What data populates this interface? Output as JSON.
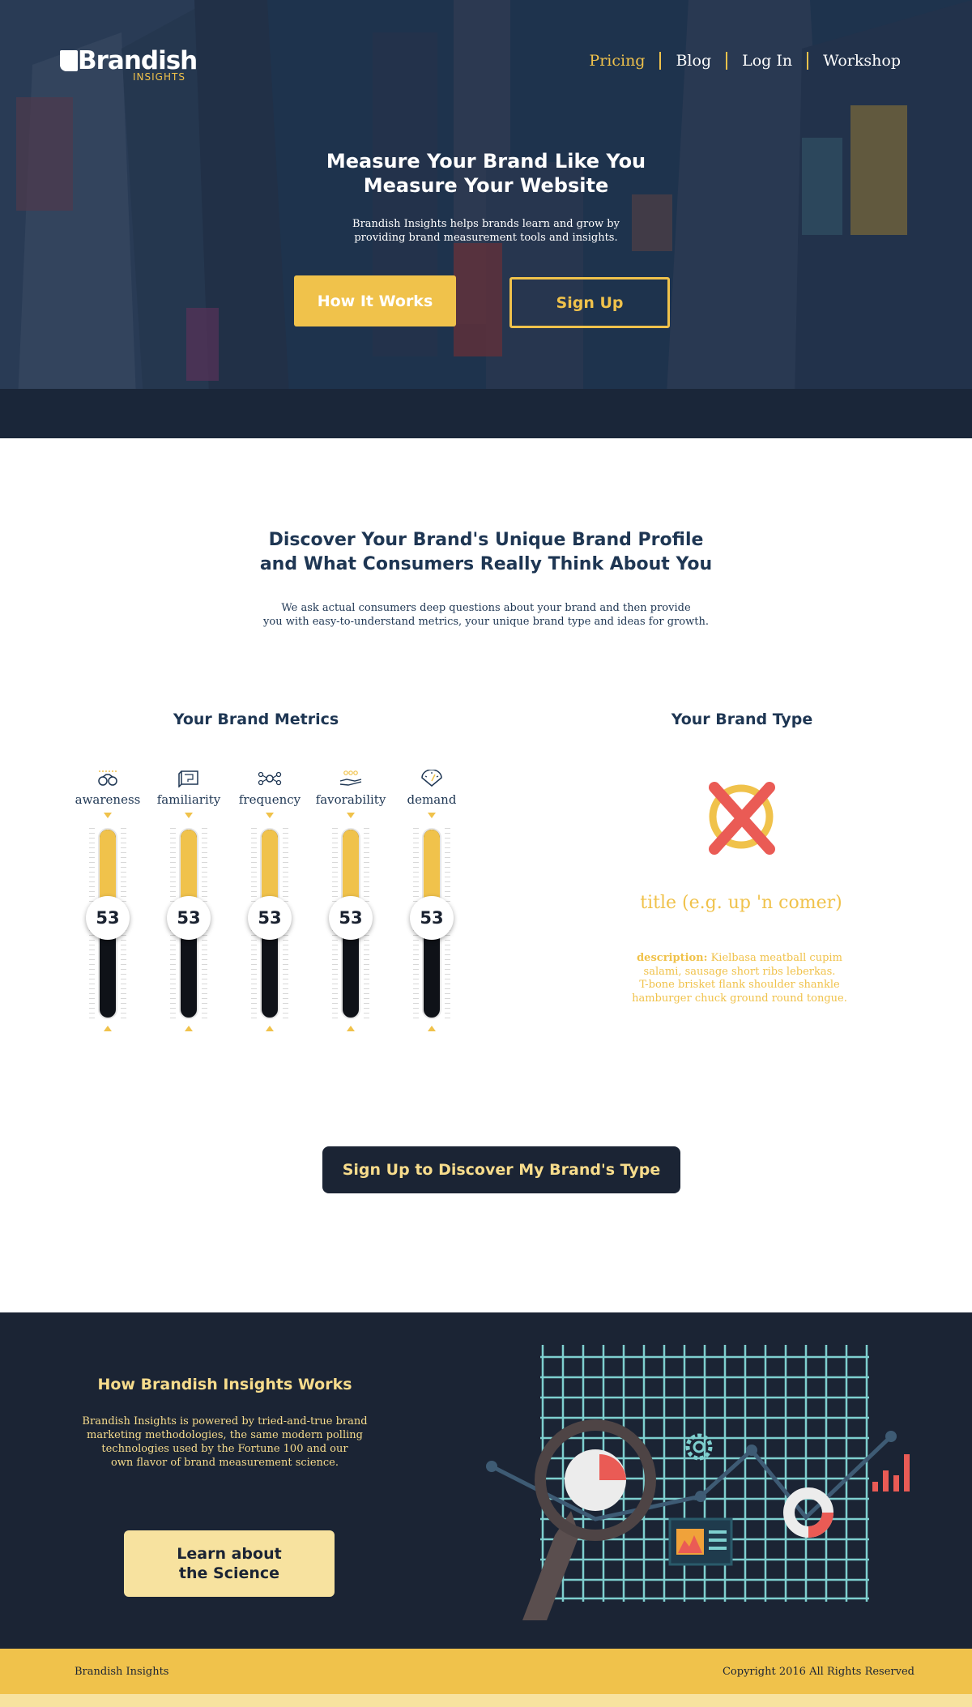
{
  "brand": {
    "name": "Brandish",
    "tagline": "INSIGHTS"
  },
  "nav": {
    "items": [
      "Pricing",
      "Blog",
      "Log In",
      "Workshop"
    ]
  },
  "hero": {
    "title_line1": "Measure Your Brand Like You",
    "title_line2": "Measure Your Website",
    "subtitle_line1": "Brandish Insights helps brands learn and grow by",
    "subtitle_line2": "providing brand measurement tools and insights.",
    "how_button": "How It Works",
    "signup_button": "Sign Up"
  },
  "discover": {
    "title_line1": "Discover Your Brand's Unique Brand Profile",
    "title_line2": "and What Consumers Really Think About You",
    "text_line1": "We ask actual consumers deep questions about your brand and then provide",
    "text_line2": "you with easy-to-understand metrics, your unique brand type and ideas for growth."
  },
  "metrics": {
    "heading": "Your Brand Metrics",
    "items": [
      {
        "label": "awareness",
        "value": "53",
        "level": 0.53,
        "icon": "binoculars-icon"
      },
      {
        "label": "familiarity",
        "value": "53",
        "level": 0.53,
        "icon": "blueprint-icon"
      },
      {
        "label": "frequency",
        "value": "53",
        "level": 0.53,
        "icon": "network-icon"
      },
      {
        "label": "favorability",
        "value": "53",
        "level": 0.53,
        "icon": "hand-coins-icon"
      },
      {
        "label": "demand",
        "value": "53",
        "level": 0.53,
        "icon": "gauge-icon"
      }
    ]
  },
  "brand_type": {
    "heading": "Your Brand Type",
    "title": "title (e.g. up 'n comer)",
    "desc_label": "description:",
    "desc_line1": " Kielbasa meatball cupim",
    "desc_line2": "salami, sausage short ribs leberkas.",
    "desc_line3": "T-bone brisket flank shoulder shankle",
    "desc_line4": "hamburger chuck ground round tongue."
  },
  "cta": {
    "label": "Sign Up to Discover My Brand's Type"
  },
  "how": {
    "title": "How Brandish Insights Works",
    "text_line1": "Brandish Insights is powered by tried-and-true brand",
    "text_line2": "marketing methodologies, the same modern polling",
    "text_line3": "technologies used by the Fortune 100 and our",
    "text_line4": "own flavor of brand measurement science.",
    "button_line1": "Learn about",
    "button_line2": "the Science"
  },
  "footer": {
    "left": "Brandish Insights",
    "right": "Copyright 2016 All Rights Reserved"
  },
  "colors": {
    "accent": "#f0c24b",
    "dark": "#1b2434",
    "navy": "#1e3653",
    "cream": "#f7e29f"
  }
}
